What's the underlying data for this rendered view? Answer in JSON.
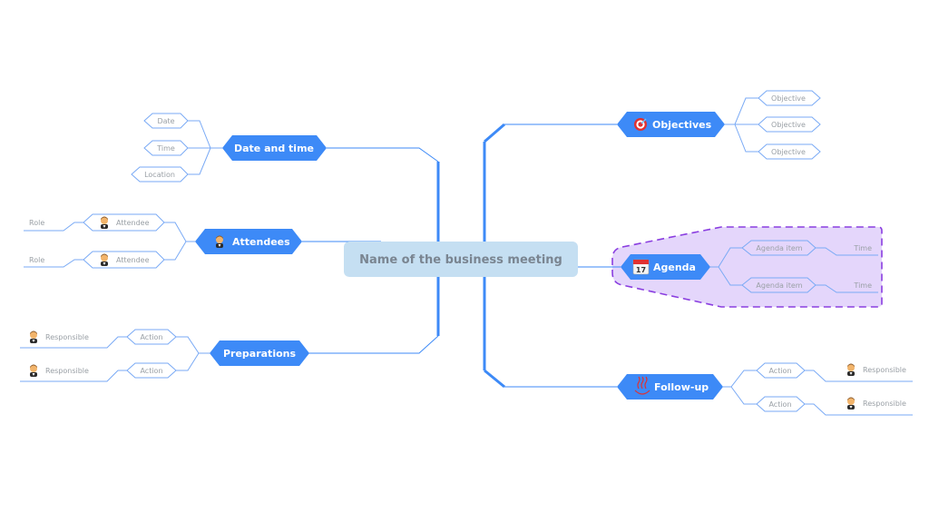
{
  "central_topic": {
    "label": "Name of the business meeting",
    "fill": "#c5dff2"
  },
  "colors": {
    "main_fill": "#3d8af7",
    "connector": "#3d8af7",
    "sub_border": "#7aaaf5",
    "boundary_fill": "#e4d6fb",
    "boundary_stroke": "#8a3ee0"
  },
  "branches": {
    "date_time": {
      "label": "Date and time",
      "icon": null,
      "children": [
        {
          "label": "Date"
        },
        {
          "label": "Time"
        },
        {
          "label": "Location"
        }
      ]
    },
    "attendees": {
      "label": "Attendees",
      "icon": "person-icon",
      "children": [
        {
          "label": "Attendee",
          "icon": "person-icon",
          "leaf": "Role"
        },
        {
          "label": "Attendee",
          "icon": "person-icon",
          "leaf": "Role"
        }
      ]
    },
    "preparations": {
      "label": "Preparations",
      "icon": null,
      "children": [
        {
          "label": "Action",
          "leaf": "Responsible",
          "leaf_icon": "person-icon"
        },
        {
          "label": "Action",
          "leaf": "Responsible",
          "leaf_icon": "person-icon"
        }
      ]
    },
    "objectives": {
      "label": "Objectives",
      "icon": "target-icon",
      "children": [
        {
          "label": "Objective"
        },
        {
          "label": "Objective"
        },
        {
          "label": "Objective"
        }
      ]
    },
    "agenda": {
      "label": "Agenda",
      "icon": "calendar-icon",
      "calendar_day": "17",
      "children": [
        {
          "label": "Agenda item",
          "leaf": "Time"
        },
        {
          "label": "Agenda item",
          "leaf": "Time"
        }
      ]
    },
    "follow_up": {
      "label": "Follow-up",
      "icon": "hot-springs-icon",
      "children": [
        {
          "label": "Action",
          "leaf": "Responsible",
          "leaf_icon": "person-icon"
        },
        {
          "label": "Action",
          "leaf": "Responsible",
          "leaf_icon": "person-icon"
        }
      ]
    }
  }
}
